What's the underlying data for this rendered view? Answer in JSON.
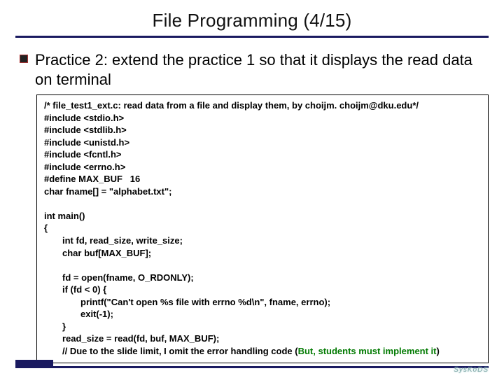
{
  "title": "File Programming (4/15)",
  "bullet": "Practice 2: extend the practice 1 so that it displays the read data on terminal",
  "code": {
    "l01": "/* file_test1_ext.c: read data from a file and display them, by choijm. choijm@dku.edu*/",
    "l02": "#include <stdio.h>",
    "l03": "#include <stdlib.h>",
    "l04": "#include <unistd.h>",
    "l05": "#include <fcntl.h>",
    "l06": "#include <errno.h>",
    "l07": "#define MAX_BUF   16",
    "l08": "char fname[] = \"alphabet.txt\";",
    "l09": "",
    "l10": "int main()",
    "l11": "{",
    "l12": "int fd, read_size, write_size;",
    "l13": "char buf[MAX_BUF];",
    "l14": "",
    "l15": "fd = open(fname, O_RDONLY);",
    "l16": "if (fd < 0) {",
    "l17": "printf(\"Can't open %s file with errno %d\\n\", fname, errno);",
    "l18": "exit(-1);",
    "l19": "}",
    "l20": "read_size = read(fd, buf, MAX_BUF);",
    "l21a": "// Due to the slide limit, I omit the error handling code (",
    "l21b": "But, students must implement it",
    "l21c": ")"
  },
  "logo": "SysKoDS"
}
